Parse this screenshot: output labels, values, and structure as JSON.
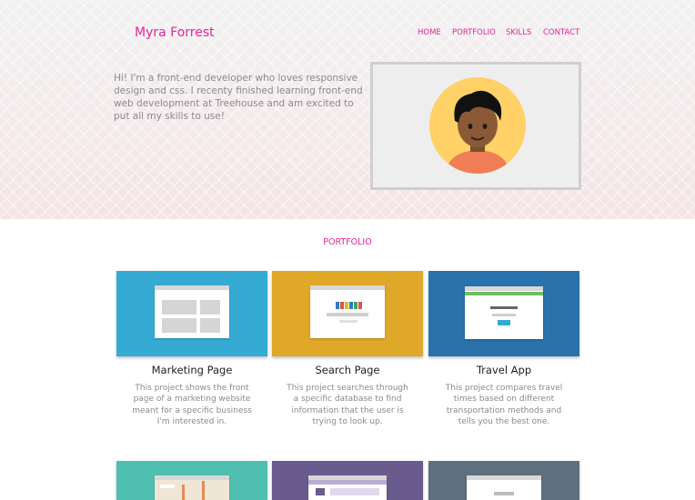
{
  "header": {
    "brand": "Myra Forrest",
    "nav": [
      "HOME",
      "PORTFOLIO",
      "SKILLS",
      "CONTACT"
    ]
  },
  "hero": {
    "intro": "Hi! I'm a front-end developer who loves responsive design and css. I recenty finished learning front-end web development at Treehouse and am excited to put all my skills to use!"
  },
  "portfolio": {
    "title": "PORTFOLIO",
    "projects": [
      {
        "title": "Marketing Page",
        "desc": "This project shows the front page of a marketing website meant for a specific business I'm interested in.",
        "color": "#35aad3"
      },
      {
        "title": "Search Page",
        "desc": "This project searches through a specific database to find information that the user is trying to look up.",
        "color": "#e0a828"
      },
      {
        "title": "Travel App",
        "desc": "This project compares travel times based on different transportation methods and tells you the best one.",
        "color": "#2a72ac"
      },
      {
        "color": "#4fbfb2"
      },
      {
        "color": "#6a5b8e"
      },
      {
        "color": "#5e6f7e"
      }
    ]
  },
  "colors": {
    "accent": "#e5259a",
    "hero_bg": "#f5eeee",
    "text_muted": "#8a8a8a"
  }
}
